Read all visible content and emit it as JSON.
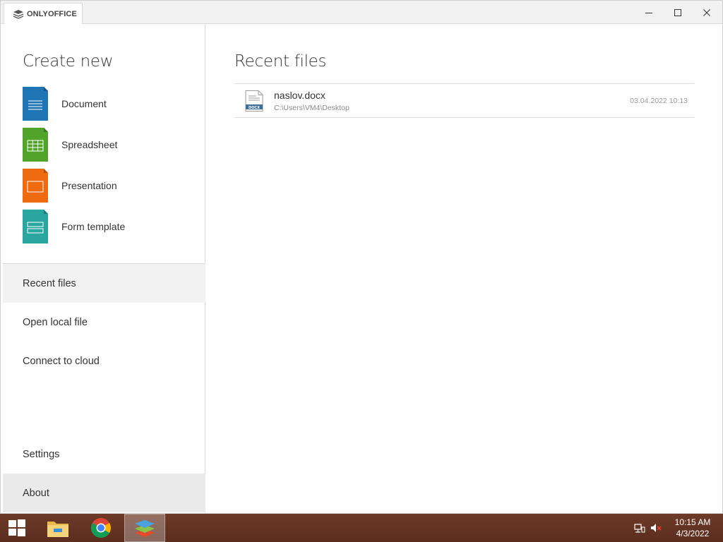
{
  "app": {
    "tab_title": "ONLYOFFICE"
  },
  "window_controls": {
    "minimize_icon": "minimize-icon",
    "maximize_icon": "maximize-icon",
    "close_icon": "close-icon"
  },
  "sidebar": {
    "create_title": "Create new",
    "create_items": [
      {
        "label": "Document",
        "color": "#1f74b4",
        "icon": "document-icon"
      },
      {
        "label": "Spreadsheet",
        "color": "#52a329",
        "icon": "spreadsheet-icon"
      },
      {
        "label": "Presentation",
        "color": "#ef6b0f",
        "icon": "presentation-icon"
      },
      {
        "label": "Form template",
        "color": "#2aa6a0",
        "icon": "form-template-icon"
      }
    ],
    "nav": [
      {
        "label": "Recent files",
        "active": true
      },
      {
        "label": "Open local file"
      },
      {
        "label": "Connect to cloud"
      }
    ],
    "settings_label": "Settings",
    "about_label": "About"
  },
  "main": {
    "title": "Recent files",
    "files": [
      {
        "name": "naslov.docx",
        "path": "C:\\Users\\VM4\\Desktop",
        "date": "03.04.2022 10:13",
        "type_badge": "DOCX"
      }
    ]
  },
  "taskbar": {
    "clock_time": "10:15 AM",
    "clock_date": "4/3/2022",
    "accent": "#5f3122"
  }
}
